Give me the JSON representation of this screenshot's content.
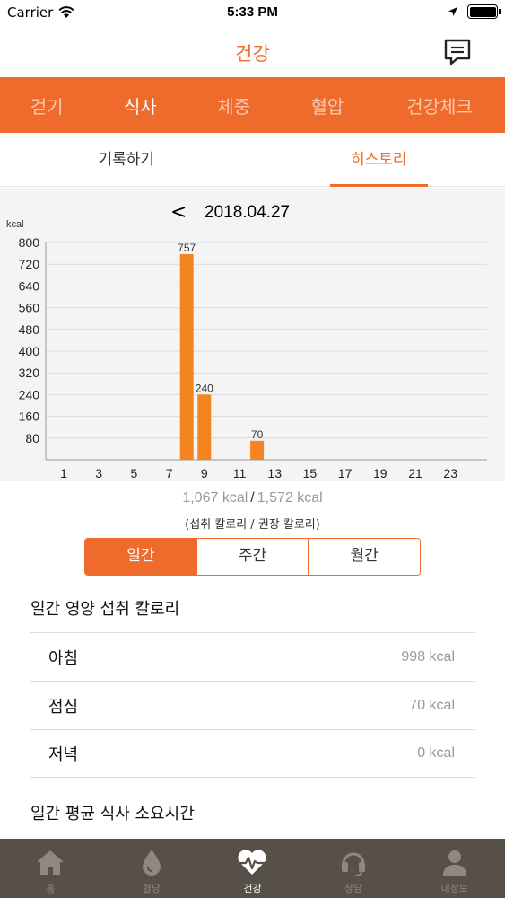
{
  "status": {
    "carrier": "Carrier",
    "time": "5:33 PM"
  },
  "header": {
    "title": "건강"
  },
  "categories": [
    {
      "label": "걷기"
    },
    {
      "label": "식사"
    },
    {
      "label": "체중"
    },
    {
      "label": "혈압"
    },
    {
      "label": "건강체크"
    }
  ],
  "sub_tabs": [
    {
      "label": "기록하기"
    },
    {
      "label": "히스토리"
    }
  ],
  "date_nav": {
    "prev": "<",
    "date": "2018.04.27"
  },
  "chart_data": {
    "type": "bar",
    "ylabel": "kcal",
    "ylim": [
      0,
      800
    ],
    "y_ticks": [
      "800",
      "720",
      "640",
      "560",
      "480",
      "400",
      "320",
      "240",
      "160",
      "80"
    ],
    "x_ticks": [
      "1",
      "3",
      "5",
      "7",
      "9",
      "11",
      "13",
      "15",
      "17",
      "19",
      "21",
      "23"
    ],
    "bars": [
      {
        "hour": 8,
        "value": 757,
        "label": "757"
      },
      {
        "hour": 9,
        "value": 240,
        "label": "240"
      },
      {
        "hour": 12,
        "value": 70,
        "label": "70"
      }
    ],
    "bar_color": "#f4841f"
  },
  "totals": {
    "intake": "1,067 kcal",
    "separator": "/",
    "recommended": "1,572 kcal",
    "caption": "(섭취 칼로리 / 권장 칼로리)"
  },
  "period": [
    {
      "label": "일간"
    },
    {
      "label": "주간"
    },
    {
      "label": "월간"
    }
  ],
  "meal_section": {
    "title": "일간 영양 섭취 칼로리",
    "rows": [
      {
        "name": "아침",
        "kcal": "998 kcal"
      },
      {
        "name": "점심",
        "kcal": "70 kcal"
      },
      {
        "name": "저녁",
        "kcal": "0 kcal"
      }
    ]
  },
  "duration_section": {
    "title": "일간 평균 식사 소요시간"
  },
  "bottom_nav": [
    {
      "label": "홈",
      "icon": "home-icon"
    },
    {
      "label": "혈당",
      "icon": "blood-drop-icon"
    },
    {
      "label": "건강",
      "icon": "heartbeat-icon"
    },
    {
      "label": "상담",
      "icon": "headset-icon"
    },
    {
      "label": "내정보",
      "icon": "person-icon"
    }
  ],
  "colors": {
    "accent": "#ef6b2c",
    "nav_bg": "#575049",
    "chart_bg": "#f4f4f4"
  }
}
